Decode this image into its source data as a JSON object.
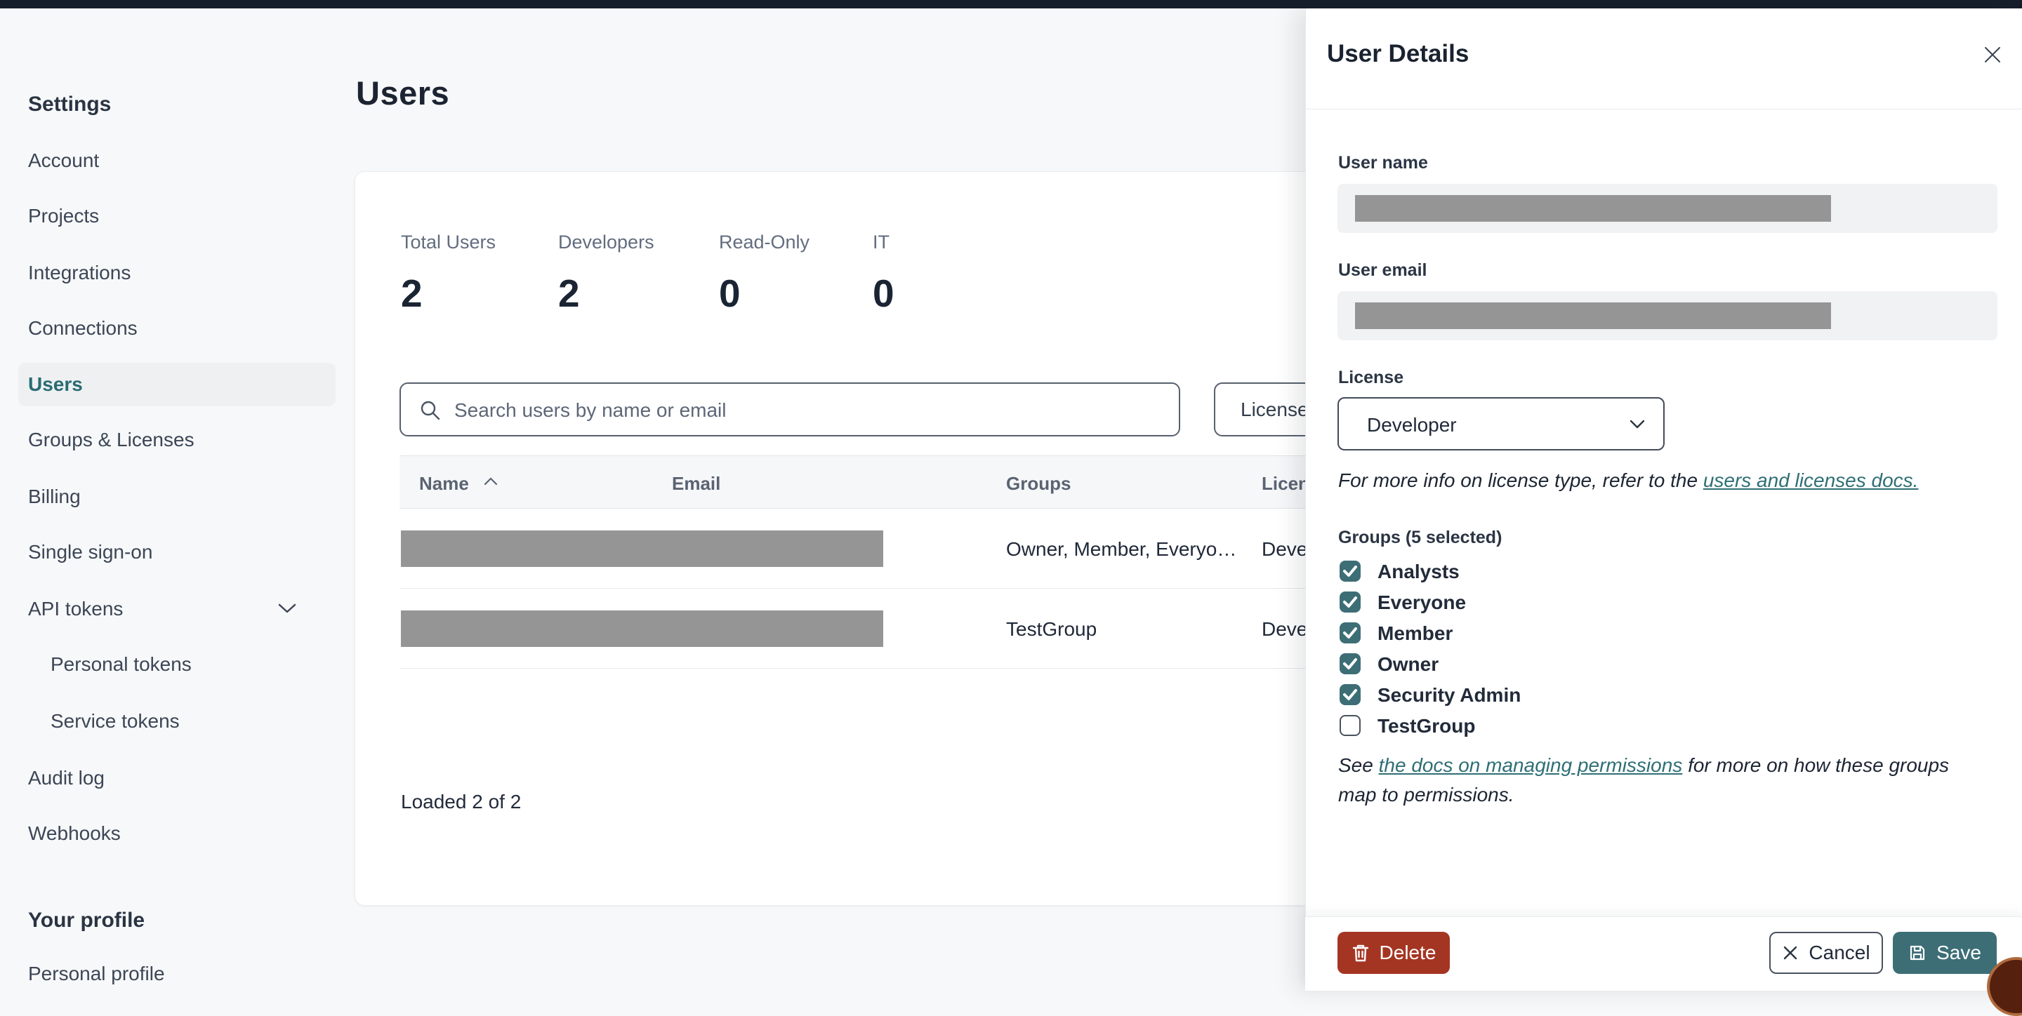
{
  "colors": {
    "topbar": "#161d2b",
    "accent_teal": "#3d6e76",
    "link_teal": "#2e6f75",
    "active_nav_teal": "#2a6b72",
    "delete_red": "#a53523",
    "page_bg": "#f7f8f9",
    "redaction_gray": "#959595"
  },
  "sidebar": {
    "title": "Settings",
    "items": [
      {
        "label": "Account"
      },
      {
        "label": "Projects"
      },
      {
        "label": "Integrations"
      },
      {
        "label": "Connections"
      },
      {
        "label": "Users",
        "active": true
      },
      {
        "label": "Groups & Licenses"
      },
      {
        "label": "Billing"
      },
      {
        "label": "Single sign-on"
      },
      {
        "label": "API tokens",
        "has_chevron": true
      },
      {
        "label": "Personal tokens",
        "indent": true
      },
      {
        "label": "Service tokens",
        "indent": true
      },
      {
        "label": "Audit log"
      },
      {
        "label": "Webhooks"
      }
    ],
    "profile_title": "Your profile",
    "profile_items": [
      {
        "label": "Personal profile"
      }
    ]
  },
  "main": {
    "title": "Users",
    "stats": [
      {
        "label": "Total Users",
        "value": "2"
      },
      {
        "label": "Developers",
        "value": "2"
      },
      {
        "label": "Read-Only",
        "value": "0"
      },
      {
        "label": "IT",
        "value": "0"
      }
    ],
    "search": {
      "placeholder": "Search users by name or email"
    },
    "license_filter_label": "License",
    "table": {
      "columns": {
        "name": "Name",
        "email": "Email",
        "groups": "Groups",
        "license": "License"
      },
      "rows": [
        {
          "groups": "Owner, Member, Everyo…",
          "license": "Developer"
        },
        {
          "groups": "TestGroup",
          "license": "Developer"
        }
      ]
    },
    "footer_status": "Loaded 2 of 2"
  },
  "drawer": {
    "title": "User Details",
    "user_name_label": "User name",
    "user_email_label": "User email",
    "license_label": "License",
    "license_value": "Developer",
    "license_note": {
      "prefix": "For more info on license type, refer to the ",
      "link": "users and licenses docs."
    },
    "groups_label": "Groups (5 selected)",
    "group_options": [
      {
        "label": "Analysts",
        "checked": true
      },
      {
        "label": "Everyone",
        "checked": true
      },
      {
        "label": "Member",
        "checked": true
      },
      {
        "label": "Owner",
        "checked": true
      },
      {
        "label": "Security Admin",
        "checked": true
      },
      {
        "label": "TestGroup",
        "checked": false
      }
    ],
    "permissions_note": {
      "prefix": "See ",
      "link": "the docs on managing permissions",
      "suffix": " for more on how these groups map to permissions."
    },
    "buttons": {
      "delete": "Delete",
      "cancel": "Cancel",
      "save": "Save"
    }
  }
}
